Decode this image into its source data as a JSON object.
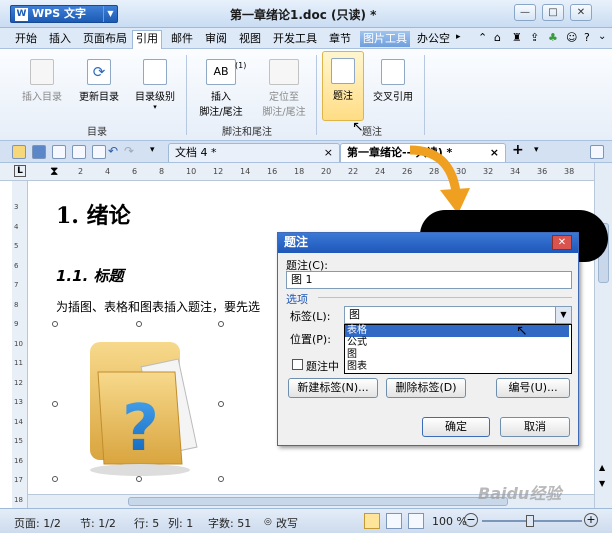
{
  "titlebar": {
    "app": "WPS 文字",
    "doc_title": "第一章绪论1.doc  (只读) *"
  },
  "menu": {
    "items": [
      "开始",
      "插入",
      "页面布局",
      "引用",
      "邮件",
      "审阅",
      "视图",
      "开发工具",
      "章节",
      "图片工具",
      "办公空"
    ],
    "active": "引用"
  },
  "ribbon": {
    "buttons": [
      "插入目录",
      "更新目录",
      "目录级别",
      "插入\n脚注/尾注",
      "定位至\n脚注/尾注",
      "题注",
      "交叉引用"
    ],
    "insert_toc": "插入目录",
    "update_toc": "更新目录",
    "toc_level": "目录级别",
    "insert_footnote_1": "插入",
    "insert_footnote_2": "脚注/尾注",
    "goto_footnote_1": "定位至",
    "goto_footnote_2": "脚注/尾注",
    "caption": "题注",
    "crossref": "交叉引用",
    "group_toc": "目录",
    "group_footnote": "脚注和尾注",
    "group_caption": "题注",
    "ab_icon": "AB",
    "ab_sup": "(1)"
  },
  "tabs": {
    "tab1": "文档 4 *",
    "tab2": "第一章绪论---只读) *",
    "close1": "×",
    "close2": "×",
    "plus": "+"
  },
  "ruler": {
    "ticks": [
      "2",
      "4",
      "6",
      "8",
      "10",
      "12",
      "14",
      "16",
      "18",
      "20",
      "22",
      "24",
      "26",
      "28",
      "30",
      "32",
      "34",
      "36",
      "38"
    ]
  },
  "vruler": {
    "ticks": [
      "3",
      "4",
      "5",
      "6",
      "7",
      "8",
      "9",
      "10",
      "11",
      "12",
      "13",
      "14",
      "15",
      "16",
      "17",
      "18"
    ]
  },
  "doc": {
    "h1": "1. 绪论",
    "h2": "1.1. 标题",
    "para": "为插图、表格和图表插入题注，要先选"
  },
  "dialog": {
    "title": "题注",
    "caption_label": "题注(C):",
    "caption_value": "图 1",
    "options_label": "选项",
    "label_label": "标签(L):",
    "label_value": "图",
    "position_label": "位置(P):",
    "dropdown_options": [
      "表格",
      "公式",
      "图",
      "图表"
    ],
    "selected_option": "表格",
    "exclude_label": "题注中",
    "new_label_button": "新建标签(N)...",
    "delete_label_button": "删除标签(D)",
    "numbering_button": "编号(U)...",
    "ok_button": "确定",
    "cancel_button": "取消"
  },
  "status": {
    "page": "页面: 1/2",
    "section": "节: 1/2",
    "line": "行: 5",
    "column": "列: 1",
    "wordcount": "字数: 51",
    "revise": "改写",
    "zoom": "100 %"
  },
  "watermark": "Baidu经验",
  "colors": {
    "accent": "#1e57b8",
    "ribbon_highlight": "#ffdd85",
    "arrow": "#f0a020"
  }
}
